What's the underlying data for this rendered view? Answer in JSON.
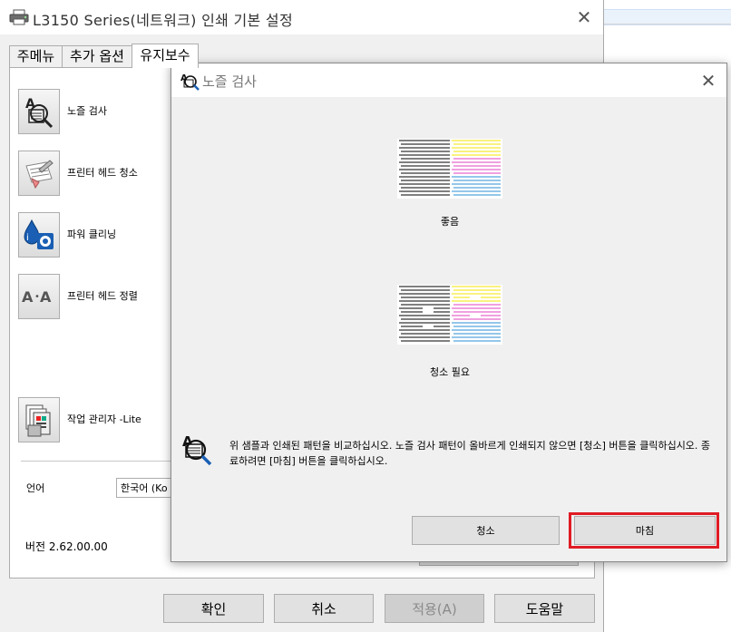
{
  "app": {
    "title": "L3150 Series(네트워크) 인쇄 기본 설정",
    "close_glyph": "✕"
  },
  "tabs": [
    {
      "label": "주메뉴"
    },
    {
      "label": "추가 옵션"
    },
    {
      "label": "유지보수",
      "active": true
    }
  ],
  "utilities": [
    {
      "label": "노즐 검사",
      "icon": "nozzle-check-icon"
    },
    {
      "label": "프린터 헤드 청소",
      "icon": "head-cleaning-icon"
    },
    {
      "label": "파워 클리닝",
      "icon": "power-cleaning-icon"
    },
    {
      "label": "프린터 헤드 정렬",
      "icon": "head-alignment-icon"
    },
    {
      "label": "작업 관리자 -Lite",
      "icon": "job-manager-icon"
    }
  ],
  "language": {
    "label": "언어",
    "value": "한국어 (Ko"
  },
  "version": "버전 2.62.00.00",
  "footer_buttons": {
    "ok": "확인",
    "cancel": "취소",
    "apply": "적용(A)",
    "help": "도움말"
  },
  "dialog": {
    "title": "노즐 검사",
    "close_glyph": "✕",
    "good_caption": "좋음",
    "bad_caption": "청소 필요",
    "instructions": "위 샘플과 인쇄된 패턴을 비교하십시오. 노즐 검사 패턴이 올바르게 인쇄되지 않으면 [청소] 버튼을 클릭하십시오. 종료하려면 [마침] 버튼을 클릭하십시오.",
    "clean_button": "청소",
    "finish_button": "마침"
  },
  "colors": {
    "highlight": "#e01b24",
    "yellow": "#f5e600",
    "magenta": "#e040c0",
    "cyan": "#2a8fd6",
    "black": "#000000"
  }
}
